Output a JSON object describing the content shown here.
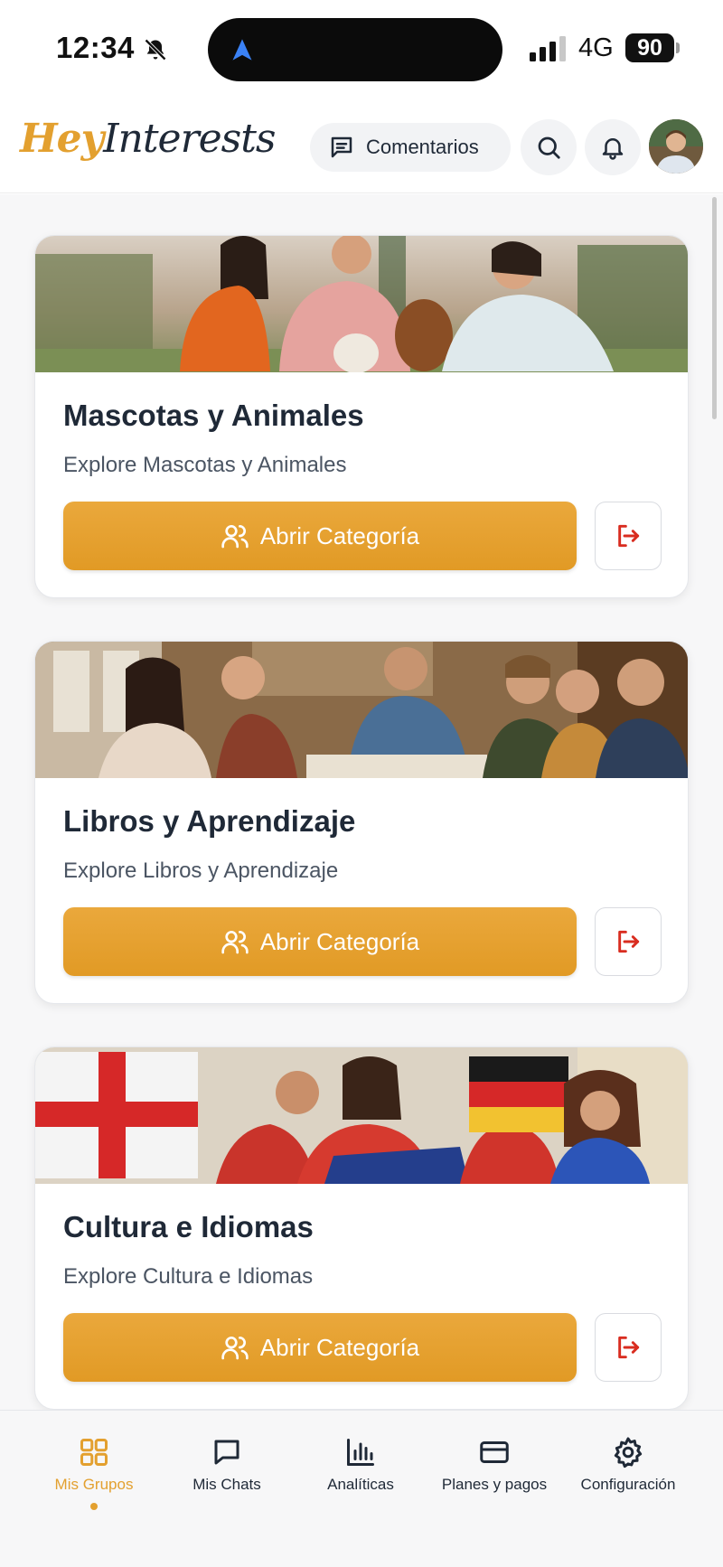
{
  "status_bar": {
    "time": "12:34",
    "network": "4G",
    "battery": "90"
  },
  "header": {
    "logo_hey": "Hey",
    "logo_interests": "Interests",
    "comments_label": "Comentarios"
  },
  "categories": [
    {
      "title": "Mascotas y Animales",
      "description": "Explore Mascotas y Animales",
      "open_label": "Abrir Categoría"
    },
    {
      "title": "Libros y Aprendizaje",
      "description": "Explore Libros y Aprendizaje",
      "open_label": "Abrir Categoría"
    },
    {
      "title": "Cultura e Idiomas",
      "description": "Explore Cultura e Idiomas",
      "open_label": "Abrir Categoría"
    }
  ],
  "bottom_nav": [
    {
      "label": "Mis Grupos",
      "icon": "grid-icon",
      "active": true
    },
    {
      "label": "Mis Chats",
      "icon": "chat-icon",
      "active": false
    },
    {
      "label": "Analíticas",
      "icon": "bar-chart-icon",
      "active": false
    },
    {
      "label": "Planes y pagos",
      "icon": "credit-card-icon",
      "active": false
    },
    {
      "label": "Configuración",
      "icon": "gear-icon",
      "active": false
    }
  ],
  "colors": {
    "accent": "#E3A02F",
    "leave_icon": "#D92D20",
    "text_dark": "#1F2937"
  }
}
